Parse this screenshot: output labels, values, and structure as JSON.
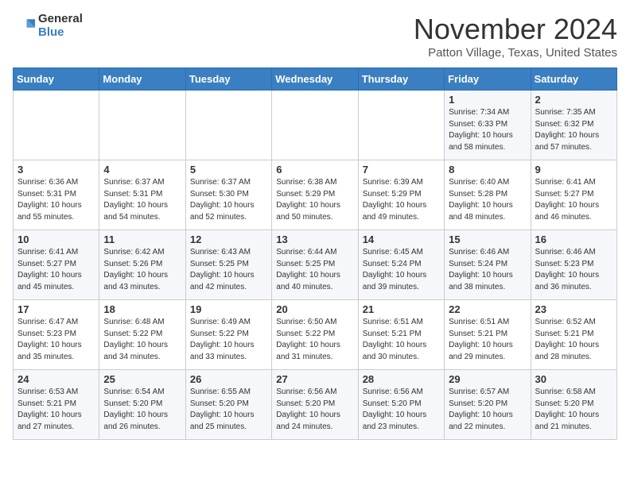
{
  "header": {
    "logo_line1": "General",
    "logo_line2": "Blue",
    "month_title": "November 2024",
    "location": "Patton Village, Texas, United States"
  },
  "days_of_week": [
    "Sunday",
    "Monday",
    "Tuesday",
    "Wednesday",
    "Thursday",
    "Friday",
    "Saturday"
  ],
  "weeks": [
    [
      {
        "day": "",
        "info": ""
      },
      {
        "day": "",
        "info": ""
      },
      {
        "day": "",
        "info": ""
      },
      {
        "day": "",
        "info": ""
      },
      {
        "day": "",
        "info": ""
      },
      {
        "day": "1",
        "info": "Sunrise: 7:34 AM\nSunset: 6:33 PM\nDaylight: 10 hours and 58 minutes."
      },
      {
        "day": "2",
        "info": "Sunrise: 7:35 AM\nSunset: 6:32 PM\nDaylight: 10 hours and 57 minutes."
      }
    ],
    [
      {
        "day": "3",
        "info": "Sunrise: 6:36 AM\nSunset: 5:31 PM\nDaylight: 10 hours and 55 minutes."
      },
      {
        "day": "4",
        "info": "Sunrise: 6:37 AM\nSunset: 5:31 PM\nDaylight: 10 hours and 54 minutes."
      },
      {
        "day": "5",
        "info": "Sunrise: 6:37 AM\nSunset: 5:30 PM\nDaylight: 10 hours and 52 minutes."
      },
      {
        "day": "6",
        "info": "Sunrise: 6:38 AM\nSunset: 5:29 PM\nDaylight: 10 hours and 50 minutes."
      },
      {
        "day": "7",
        "info": "Sunrise: 6:39 AM\nSunset: 5:29 PM\nDaylight: 10 hours and 49 minutes."
      },
      {
        "day": "8",
        "info": "Sunrise: 6:40 AM\nSunset: 5:28 PM\nDaylight: 10 hours and 48 minutes."
      },
      {
        "day": "9",
        "info": "Sunrise: 6:41 AM\nSunset: 5:27 PM\nDaylight: 10 hours and 46 minutes."
      }
    ],
    [
      {
        "day": "10",
        "info": "Sunrise: 6:41 AM\nSunset: 5:27 PM\nDaylight: 10 hours and 45 minutes."
      },
      {
        "day": "11",
        "info": "Sunrise: 6:42 AM\nSunset: 5:26 PM\nDaylight: 10 hours and 43 minutes."
      },
      {
        "day": "12",
        "info": "Sunrise: 6:43 AM\nSunset: 5:25 PM\nDaylight: 10 hours and 42 minutes."
      },
      {
        "day": "13",
        "info": "Sunrise: 6:44 AM\nSunset: 5:25 PM\nDaylight: 10 hours and 40 minutes."
      },
      {
        "day": "14",
        "info": "Sunrise: 6:45 AM\nSunset: 5:24 PM\nDaylight: 10 hours and 39 minutes."
      },
      {
        "day": "15",
        "info": "Sunrise: 6:46 AM\nSunset: 5:24 PM\nDaylight: 10 hours and 38 minutes."
      },
      {
        "day": "16",
        "info": "Sunrise: 6:46 AM\nSunset: 5:23 PM\nDaylight: 10 hours and 36 minutes."
      }
    ],
    [
      {
        "day": "17",
        "info": "Sunrise: 6:47 AM\nSunset: 5:23 PM\nDaylight: 10 hours and 35 minutes."
      },
      {
        "day": "18",
        "info": "Sunrise: 6:48 AM\nSunset: 5:22 PM\nDaylight: 10 hours and 34 minutes."
      },
      {
        "day": "19",
        "info": "Sunrise: 6:49 AM\nSunset: 5:22 PM\nDaylight: 10 hours and 33 minutes."
      },
      {
        "day": "20",
        "info": "Sunrise: 6:50 AM\nSunset: 5:22 PM\nDaylight: 10 hours and 31 minutes."
      },
      {
        "day": "21",
        "info": "Sunrise: 6:51 AM\nSunset: 5:21 PM\nDaylight: 10 hours and 30 minutes."
      },
      {
        "day": "22",
        "info": "Sunrise: 6:51 AM\nSunset: 5:21 PM\nDaylight: 10 hours and 29 minutes."
      },
      {
        "day": "23",
        "info": "Sunrise: 6:52 AM\nSunset: 5:21 PM\nDaylight: 10 hours and 28 minutes."
      }
    ],
    [
      {
        "day": "24",
        "info": "Sunrise: 6:53 AM\nSunset: 5:21 PM\nDaylight: 10 hours and 27 minutes."
      },
      {
        "day": "25",
        "info": "Sunrise: 6:54 AM\nSunset: 5:20 PM\nDaylight: 10 hours and 26 minutes."
      },
      {
        "day": "26",
        "info": "Sunrise: 6:55 AM\nSunset: 5:20 PM\nDaylight: 10 hours and 25 minutes."
      },
      {
        "day": "27",
        "info": "Sunrise: 6:56 AM\nSunset: 5:20 PM\nDaylight: 10 hours and 24 minutes."
      },
      {
        "day": "28",
        "info": "Sunrise: 6:56 AM\nSunset: 5:20 PM\nDaylight: 10 hours and 23 minutes."
      },
      {
        "day": "29",
        "info": "Sunrise: 6:57 AM\nSunset: 5:20 PM\nDaylight: 10 hours and 22 minutes."
      },
      {
        "day": "30",
        "info": "Sunrise: 6:58 AM\nSunset: 5:20 PM\nDaylight: 10 hours and 21 minutes."
      }
    ]
  ]
}
